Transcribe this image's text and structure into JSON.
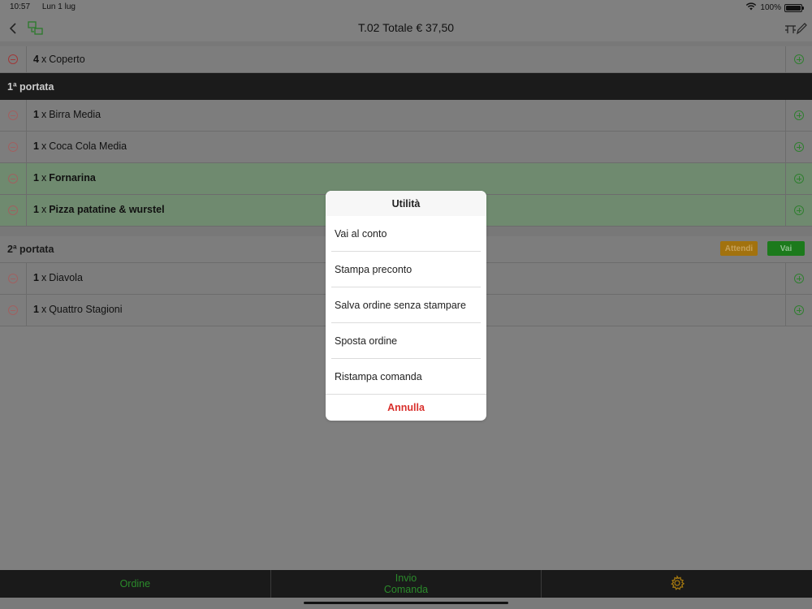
{
  "status": {
    "time": "10:57",
    "date": "Lun 1 lug",
    "battery": "100%",
    "battery_level": 1.0
  },
  "nav": {
    "title": "T.02 Totale € 37,50",
    "back_icon": "chevron-left-icon",
    "move_icon": "move-table-icon",
    "edit_icon": "table-edit-icon"
  },
  "cover": {
    "qty": "4",
    "mul": "x",
    "name": "Coperto"
  },
  "course1": {
    "label": "1ª portata",
    "items": [
      {
        "qty": "1",
        "mul": "x",
        "name": "Birra Media"
      },
      {
        "qty": "1",
        "mul": "x",
        "name": "Coca Cola Media"
      },
      {
        "qty": "1",
        "mul": "x",
        "name": "Fornarina"
      },
      {
        "qty": "1",
        "mul": "x",
        "name": "Pizza patatine & wurstel"
      }
    ]
  },
  "course2": {
    "label": "2ª portata",
    "attendi": "Attendi",
    "vai": "Vai",
    "items": [
      {
        "qty": "1",
        "mul": "x",
        "name": "Diavola"
      },
      {
        "qty": "1",
        "mul": "x",
        "name": "Quattro Stagioni"
      }
    ]
  },
  "tabs": {
    "ordine": "Ordine",
    "invio_line1": "Invio",
    "invio_line2": "Comanda",
    "settings_icon": "gear-icon"
  },
  "sheet": {
    "title": "Utilità",
    "options": [
      "Vai al conto",
      "Stampa preconto",
      "Salva ordine senza stampare",
      "Sposta ordine",
      "Ristampa comanda"
    ],
    "cancel": "Annulla"
  },
  "colors": {
    "accent_green": "#2b8b2b",
    "cancel_red": "#d9302c",
    "attendi_orange": "#a2720e",
    "vai_green": "#1c7a1c"
  }
}
